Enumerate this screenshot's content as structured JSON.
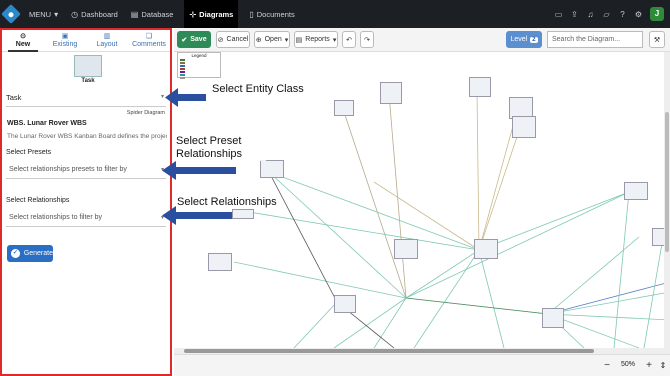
{
  "nav": {
    "menu_label": "MENU",
    "items": [
      {
        "label": "Dashboard",
        "icon": "dashboard-icon"
      },
      {
        "label": "Database",
        "icon": "database-icon"
      },
      {
        "label": "Diagrams",
        "icon": "diagram-icon"
      },
      {
        "label": "Documents",
        "icon": "document-icon"
      }
    ],
    "right_icons": [
      "chat-icon",
      "share-icon",
      "bell-icon",
      "folder-icon",
      "help-icon",
      "settings-icon"
    ],
    "avatar_letter": "J"
  },
  "left_panel": {
    "tabs": [
      {
        "label": "New",
        "icon": "new-icon"
      },
      {
        "label": "Existing",
        "icon": "existing-icon"
      },
      {
        "label": "Layout",
        "icon": "layout-icon"
      },
      {
        "label": "Comments",
        "icon": "comments-icon"
      }
    ],
    "selected_class": "Task",
    "entity_select_value": "Task",
    "diagram_type": "Spider Diagram",
    "entity_title": "WBS. Lunar Rover WBS",
    "entity_description": "The Lunar Rover WBS Kanban Board defines the project's",
    "presets_label": "Select Presets",
    "presets_placeholder": "Select relationships presets to filter by",
    "relationships_label": "Select Relationships",
    "relationships_placeholder": "Select relationships to filter by",
    "generate_label": "Generate"
  },
  "toolbar": {
    "save_label": "Save",
    "cancel_label": "Cancel",
    "open_label": "Open",
    "reports_label": "Reports",
    "level_label": "Level",
    "level_value": "2",
    "search_placeholder": "Search the Diagram..."
  },
  "canvas": {
    "legend_title": "Legend",
    "legend_colors": [
      "#3a7d44",
      "#8a6d3b",
      "#2b6cb0",
      "#b03a2e",
      "#6a1b9a",
      "#2c9c8f",
      "#999999"
    ]
  },
  "zoom": {
    "level": "50%"
  },
  "annotations": {
    "select_entity_class": "Select Entity Class",
    "select_preset_relationships": "Select Preset Relationships",
    "select_relationships": "Select Relationships",
    "color": "#2a4f9e"
  }
}
